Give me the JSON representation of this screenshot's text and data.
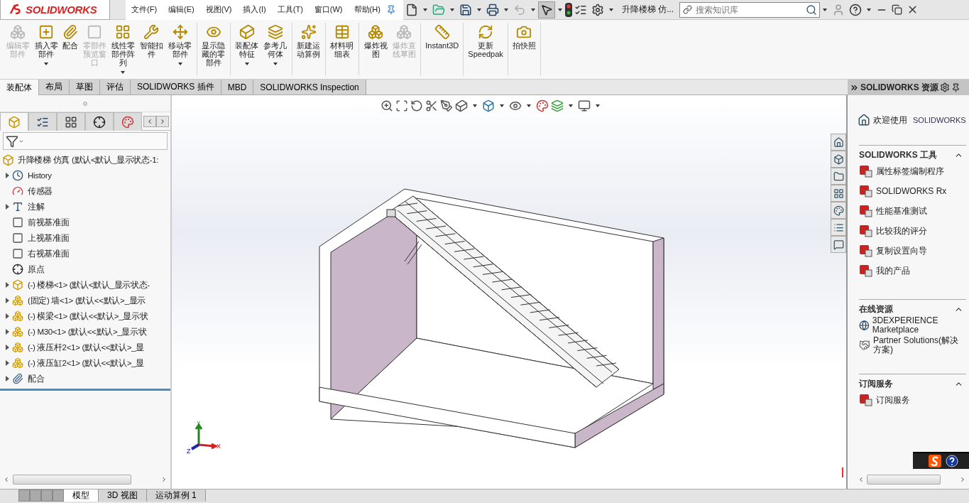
{
  "logo": "SOLIDWORKS",
  "menu": [
    "文件(F)",
    "编辑(E)",
    "视图(V)",
    "插入(I)",
    "工具(T)",
    "窗口(W)",
    "帮助(H)"
  ],
  "document_title": "升降楼梯 仿...",
  "search": {
    "placeholder": "搜索知识库"
  },
  "command_groups": [
    [
      {
        "label": "编辑零部件",
        "disabled": true,
        "dropdown": false
      },
      {
        "label": "插入零部件",
        "disabled": false,
        "dropdown": true
      },
      {
        "label": "配合",
        "disabled": false,
        "dropdown": false
      },
      {
        "label": "零部件预览窗口",
        "disabled": true,
        "dropdown": false
      },
      {
        "label": "线性零部件阵列",
        "disabled": false,
        "dropdown": true
      },
      {
        "label": "智能扣件",
        "disabled": false,
        "dropdown": false
      },
      {
        "label": "移动零部件",
        "disabled": false,
        "dropdown": true
      }
    ],
    [
      {
        "label": "显示隐藏的零部件",
        "disabled": false,
        "dropdown": false
      }
    ],
    [
      {
        "label": "装配体特征",
        "disabled": false,
        "dropdown": true
      },
      {
        "label": "参考几何体",
        "disabled": false,
        "dropdown": true
      }
    ],
    [
      {
        "label": "新建运动算例",
        "disabled": false,
        "dropdown": false
      }
    ],
    [
      {
        "label": "材料明细表",
        "disabled": false,
        "dropdown": false
      }
    ],
    [
      {
        "label": "爆炸视图",
        "disabled": false,
        "dropdown": false
      },
      {
        "label": "爆炸直线草图",
        "disabled": true,
        "dropdown": false
      }
    ],
    [
      {
        "label": "Instant3D",
        "disabled": false,
        "dropdown": false
      }
    ],
    [
      {
        "label": "更新 Speedpak",
        "disabled": false,
        "dropdown": false
      }
    ],
    [
      {
        "label": "拍快照",
        "disabled": false,
        "dropdown": false
      }
    ]
  ],
  "tabs": [
    {
      "label": "装配体",
      "selected": true
    },
    {
      "label": "布局",
      "selected": false
    },
    {
      "label": "草图",
      "selected": false
    },
    {
      "label": "评估",
      "selected": false
    },
    {
      "label": "SOLIDWORKS 插件",
      "selected": false
    },
    {
      "label": "MBD",
      "selected": false
    },
    {
      "label": "SOLIDWORKS Inspection",
      "selected": false
    }
  ],
  "panel_tabs": [
    {
      "selected": true
    },
    {
      "selected": false
    },
    {
      "selected": false
    },
    {
      "selected": false
    },
    {
      "selected": false
    }
  ],
  "tree": {
    "root": "升降楼梯 仿真 (默认<默认_显示状态-1:",
    "items": [
      {
        "kind": "history",
        "label": "History",
        "collapsible": true
      },
      {
        "kind": "sensor",
        "label": "传感器",
        "collapsible": false
      },
      {
        "kind": "annotation",
        "label": "注解",
        "collapsible": true
      },
      {
        "kind": "plane",
        "label": "前视基准面",
        "collapsible": false
      },
      {
        "kind": "plane",
        "label": "上视基准面",
        "collapsible": false
      },
      {
        "kind": "plane",
        "label": "右视基准面",
        "collapsible": false
      },
      {
        "kind": "origin",
        "label": "原点",
        "collapsible": false
      },
      {
        "kind": "assembly",
        "label": "(-) 楼梯<1> (默认<默认_显示状态-",
        "collapsible": true
      },
      {
        "kind": "part",
        "label": "(固定) 墙<1> (默认<<默认>_显示",
        "collapsible": true
      },
      {
        "kind": "part",
        "label": "(-) 横梁<1> (默认<<默认>_显示状",
        "collapsible": true
      },
      {
        "kind": "part",
        "label": "(-) M30<1> (默认<<默认>_显示状",
        "collapsible": true
      },
      {
        "kind": "part",
        "label": "(-) 液压杆2<1> (默认<<默认>_显",
        "collapsible": true
      },
      {
        "kind": "part",
        "label": "(-) 液压缸2<1> (默认<<默认>_显",
        "collapsible": true
      },
      {
        "kind": "mates",
        "label": "配合",
        "collapsible": true
      }
    ]
  },
  "triad": {
    "x": "X",
    "y": "Y",
    "z": "Z"
  },
  "taskpane": {
    "title": "SOLIDWORKS 资源",
    "welcome": "欢迎使用",
    "welcome_brand": "SOLIDWORKS",
    "sections": [
      {
        "title": "SOLIDWORKS 工具",
        "expanded": true,
        "items": [
          "属性标签编制程序",
          "SOLIDWORKS Rx",
          "性能基准测试",
          "比较我的评分",
          "复制设置向导",
          "我的产品"
        ]
      },
      {
        "title": "在线资源",
        "expanded": true,
        "items": [
          "3DEXPERIENCE Marketplace",
          "Partner Solutions(解决方案)"
        ]
      },
      {
        "title": "订阅服务",
        "expanded": true,
        "items": [
          "订阅服务"
        ]
      }
    ]
  },
  "bottom_tabs": [
    {
      "label": "模型",
      "selected": true
    },
    {
      "label": "3D 视图",
      "selected": false
    },
    {
      "label": "运动算例 1",
      "selected": false
    }
  ]
}
